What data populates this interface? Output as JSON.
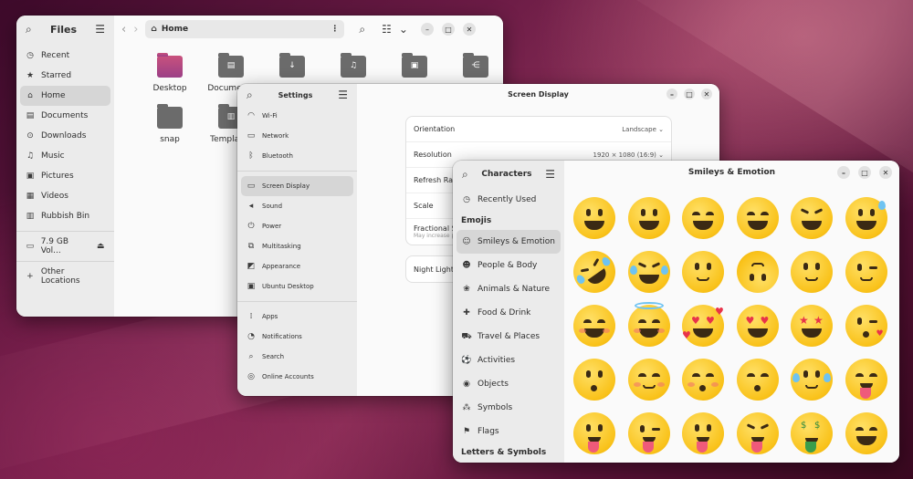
{
  "files": {
    "title": "Files",
    "path": "Home",
    "sidebar": [
      {
        "label": "Recent",
        "icon": "clock-icon"
      },
      {
        "label": "Starred",
        "icon": "star-icon"
      },
      {
        "label": "Home",
        "icon": "home-icon"
      },
      {
        "label": "Documents",
        "icon": "document-icon"
      },
      {
        "label": "Downloads",
        "icon": "download-icon"
      },
      {
        "label": "Music",
        "icon": "music-icon"
      },
      {
        "label": "Pictures",
        "icon": "picture-icon"
      },
      {
        "label": "Videos",
        "icon": "video-icon"
      },
      {
        "label": "Rubbish Bin",
        "icon": "trash-icon"
      },
      {
        "label": "7.9 GB Vol...",
        "icon": "drive-icon"
      },
      {
        "label": "Other Locations",
        "icon": "plus-icon"
      }
    ],
    "folders": [
      {
        "label": "Desktop",
        "icon": "desktop-folder-icon",
        "color": "#b04a7a"
      },
      {
        "label": "Documents",
        "icon": "documents-folder-icon",
        "color": "#6b6b6b"
      },
      {
        "label": "",
        "icon": "downloads-folder-icon",
        "color": "#6b6b6b"
      },
      {
        "label": "",
        "icon": "music-folder-icon",
        "color": "#6b6b6b"
      },
      {
        "label": "",
        "icon": "pictures-folder-icon",
        "color": "#6b6b6b"
      },
      {
        "label": "",
        "icon": "public-folder-icon",
        "color": "#6b6b6b"
      },
      {
        "label": "snap",
        "icon": "snap-folder-icon",
        "color": "#6b6b6b"
      },
      {
        "label": "Templates",
        "icon": "templates-folder-icon",
        "color": "#6b6b6b"
      }
    ]
  },
  "settings": {
    "title": "Settings",
    "page_title": "Screen Display",
    "sidebar": [
      {
        "label": "Wi-Fi",
        "icon": "wifi-icon"
      },
      {
        "label": "Network",
        "icon": "network-icon"
      },
      {
        "label": "Bluetooth",
        "icon": "bluetooth-icon"
      },
      {
        "label": "Screen Display",
        "icon": "display-icon"
      },
      {
        "label": "Sound",
        "icon": "sound-icon"
      },
      {
        "label": "Power",
        "icon": "power-icon"
      },
      {
        "label": "Multitasking",
        "icon": "multitasking-icon"
      },
      {
        "label": "Appearance",
        "icon": "appearance-icon"
      },
      {
        "label": "Ubuntu Desktop",
        "icon": "ubuntu-desktop-icon"
      },
      {
        "label": "Apps",
        "icon": "apps-icon"
      },
      {
        "label": "Notifications",
        "icon": "bell-icon"
      },
      {
        "label": "Search",
        "icon": "search-icon"
      },
      {
        "label": "Online Accounts",
        "icon": "accounts-icon"
      }
    ],
    "rows": [
      {
        "label": "Orientation",
        "value": "Landscape"
      },
      {
        "label": "Resolution",
        "value": "1920 × 1080 (16:9)"
      },
      {
        "label": "Refresh Rate",
        "value": ""
      },
      {
        "label": "Scale",
        "value": ""
      },
      {
        "label": "Fractional Sca",
        "sub": "May increase po",
        "value": ""
      }
    ],
    "night_light": "Night Light"
  },
  "characters": {
    "title": "Characters",
    "page_title": "Smileys & Emotion",
    "recently_used": "Recently Used",
    "emojis_section": "Emojis",
    "categories": [
      {
        "label": "Smileys & Emotion",
        "icon": "smiley-icon"
      },
      {
        "label": "People & Body",
        "icon": "person-icon"
      },
      {
        "label": "Animals & Nature",
        "icon": "paw-icon"
      },
      {
        "label": "Food & Drink",
        "icon": "food-icon"
      },
      {
        "label": "Travel & Places",
        "icon": "car-icon"
      },
      {
        "label": "Activities",
        "icon": "ball-icon"
      },
      {
        "label": "Objects",
        "icon": "bulb-icon"
      },
      {
        "label": "Symbols",
        "icon": "symbols-icon"
      },
      {
        "label": "Flags",
        "icon": "flag-icon"
      }
    ],
    "letters_section": "Letters & Symbols",
    "emojis": [
      "grinning-face",
      "grinning-face-big-eyes",
      "grinning-face-smiling-eyes",
      "beaming-face",
      "squinting-face",
      "grinning-sweat",
      "rolling-laughing",
      "tears-of-joy",
      "slightly-smiling",
      "upside-down",
      "melting-face",
      "winking-face",
      "smiling-eyes",
      "halo-face",
      "smiling-hearts",
      "heart-eyes",
      "star-struck",
      "blowing-kiss",
      "kissing-face",
      "smiling-face",
      "kissing-smiling-eyes",
      "kissing-closed-eyes",
      "holding-back-tears",
      "face-savoring",
      "tongue-out",
      "winking-tongue",
      "zany-face",
      "squinting-tongue",
      "money-mouth",
      "hugging-face"
    ]
  }
}
